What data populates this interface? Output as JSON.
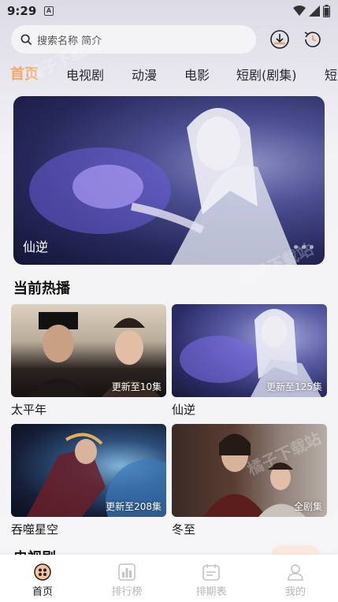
{
  "status_bar": {
    "time": "9:29",
    "notification_glyph": "A"
  },
  "search": {
    "placeholder": "搜索名称 简介"
  },
  "header_icons": [
    "download-icon",
    "history-icon"
  ],
  "tabs": [
    {
      "label": "首页",
      "active": true
    },
    {
      "label": "电视剧",
      "active": false
    },
    {
      "label": "动漫",
      "active": false
    },
    {
      "label": "电影",
      "active": false
    },
    {
      "label": "短剧(剧集)",
      "active": false
    },
    {
      "label": "短",
      "active": false
    }
  ],
  "banner": {
    "caption": "仙逆",
    "slides": 3,
    "current": 0
  },
  "hot": {
    "title": "当前热播",
    "cards": [
      {
        "title": "太平年",
        "badge": "更新至10集"
      },
      {
        "title": "仙逆",
        "badge": "更新至125集"
      },
      {
        "title": "吞噬星空",
        "badge": "更新至208集"
      },
      {
        "title": "冬至",
        "badge": "全剧集"
      }
    ]
  },
  "next_section": {
    "title": "电视剧"
  },
  "watermark": "橘子下载站",
  "bottom_nav": [
    {
      "label": "首页",
      "icon": "home-icon",
      "active": true
    },
    {
      "label": "排行榜",
      "icon": "ranking-icon",
      "active": false
    },
    {
      "label": "排期表",
      "icon": "schedule-icon",
      "active": false
    },
    {
      "label": "我的",
      "icon": "profile-icon",
      "active": false
    }
  ],
  "colors": {
    "accent": "#f3a76a",
    "nav_inactive": "#b8b8b8",
    "pill_text": "#f07b5a"
  }
}
